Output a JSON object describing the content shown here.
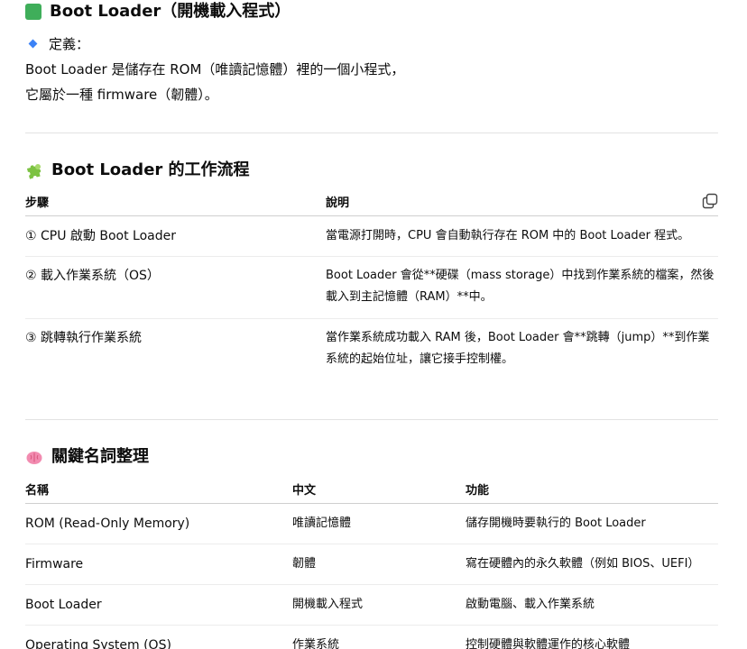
{
  "section1": {
    "title": "Boot Loader（開機載入程式）",
    "definition_label": "定義：",
    "line1": "Boot Loader 是儲存在 ROM（唯讀記憶體）裡的一個小程式，",
    "line2": "它屬於一種 firmware（韌體）。"
  },
  "section2": {
    "title": "Boot Loader 的工作流程",
    "headers": [
      "步驟",
      "說明"
    ],
    "rows": [
      {
        "step": "① CPU 啟動 Boot Loader",
        "desc": "當電源打開時，CPU 會自動執行存在 ROM 中的 Boot Loader 程式。"
      },
      {
        "step": "② 載入作業系統（OS）",
        "desc": "Boot Loader 會從**硬碟（mass storage）中找到作業系統的檔案，然後載入到主記憶體（RAM）**中。"
      },
      {
        "step": "③ 跳轉執行作業系統",
        "desc": "當作業系統成功載入 RAM 後，Boot Loader 會**跳轉（jump）**到作業系統的起始位址，讓它接手控制權。"
      }
    ]
  },
  "section3": {
    "title": "關鍵名詞整理",
    "headers": [
      "名稱",
      "中文",
      "功能"
    ],
    "rows": [
      {
        "name": "ROM (Read-Only Memory)",
        "zh": "唯讀記憶體",
        "func": "儲存開機時要執行的 Boot Loader"
      },
      {
        "name": "Firmware",
        "zh": "韌體",
        "func": "寫在硬體內的永久軟體（例如 BIOS、UEFI）"
      },
      {
        "name": "Boot Loader",
        "zh": "開機載入程式",
        "func": "啟動電腦、載入作業系統"
      },
      {
        "name": "Operating System (OS)",
        "zh": "作業系統",
        "func": "控制硬體與軟體運作的核心軟體"
      }
    ]
  },
  "icons": {
    "section1": "green-square-icon",
    "definition": "blue-diamond-icon",
    "section2": "puzzle-piece-icon",
    "section3": "brain-icon",
    "copy": "copy-icon"
  },
  "colors": {
    "green_square": "#3fae5a",
    "blue_diamond": "#3b82f6",
    "puzzle": "#7cc242",
    "brain": "#f28bb0"
  }
}
